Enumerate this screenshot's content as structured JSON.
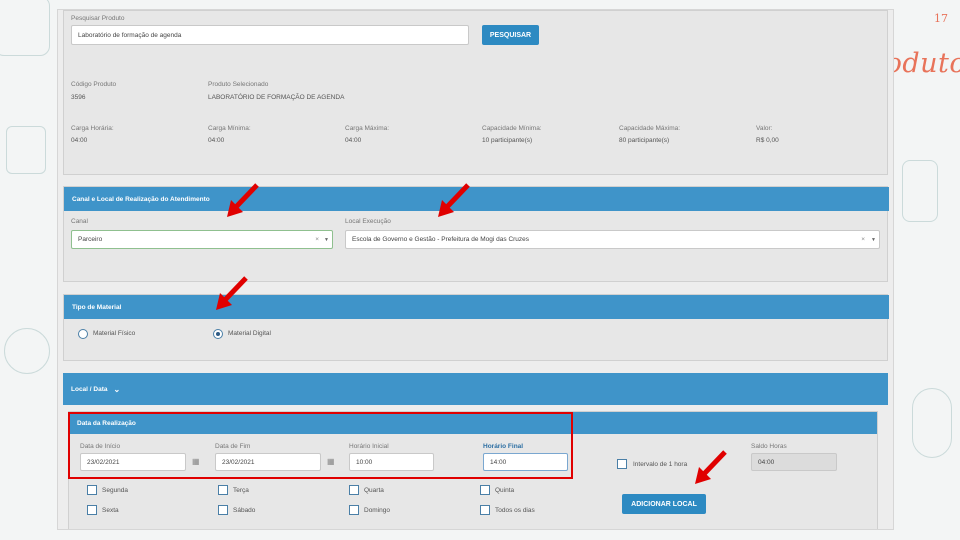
{
  "slide": {
    "title": "Agendamento de Produtos",
    "number": "17"
  },
  "search": {
    "label": "Pesquisar Produto",
    "value": "Laboratório de formação de agenda",
    "button": "PESQUISAR"
  },
  "product": {
    "code_label": "Código Produto",
    "code": "3596",
    "selected_label": "Produto Selecionado",
    "selected": "LABORATÓRIO DE FORMAÇÃO DE AGENDA",
    "workload_label": "Carga Horária:",
    "workload": "04:00",
    "min_load_label": "Carga Mínima:",
    "min_load": "04:00",
    "max_load_label": "Carga Máxima:",
    "max_load": "04:00",
    "min_cap_label": "Capacidade Mínima:",
    "min_cap": "10 participante(s)",
    "max_cap_label": "Capacidade Máxima:",
    "max_cap": "80 participante(s)",
    "value_label": "Valor:",
    "value": "R$ 0,00"
  },
  "channel_section": {
    "title": "Canal e Local de Realização do Atendimento",
    "channel_label": "Canal",
    "channel": "Parceiro",
    "location_label": "Local Execução",
    "location": "Escola de Governo e Gestão - Prefeitura de Mogi das Cruzes"
  },
  "material_section": {
    "title": "Tipo de Material",
    "physical": "Material Físico",
    "digital": "Material Digital",
    "selected": "digital"
  },
  "local_section": {
    "title": "Local / Data",
    "chevron": "⌄"
  },
  "date_section": {
    "title": "Data da Realização",
    "start_label": "Data de Início",
    "start": "23/02/2021",
    "end_label": "Data de Fim",
    "end": "23/02/2021",
    "start_time_label": "Horário Inicial",
    "start_time": "10:00",
    "end_time_label": "Horário Final",
    "end_time": "14:00",
    "interval_label": "Intervalo de 1 hora",
    "balance_label": "Saldo Horas",
    "balance": "04:00",
    "add_button": "ADICIONAR LOCAL"
  },
  "days": [
    "Segunda",
    "Terça",
    "Quarta",
    "Quinta",
    "Sexta",
    "Sábado",
    "Domingo",
    "Todos os dias"
  ],
  "colors": {
    "accent": "#3f94c9",
    "button": "#2d8ac2",
    "highlight": "#e00000",
    "title": "#e8735a"
  },
  "icons": {
    "calendar": "calendar-icon",
    "clear": "clear-icon",
    "dropdown": "chevron-down-icon",
    "arrow": "red-arrow-icon"
  }
}
